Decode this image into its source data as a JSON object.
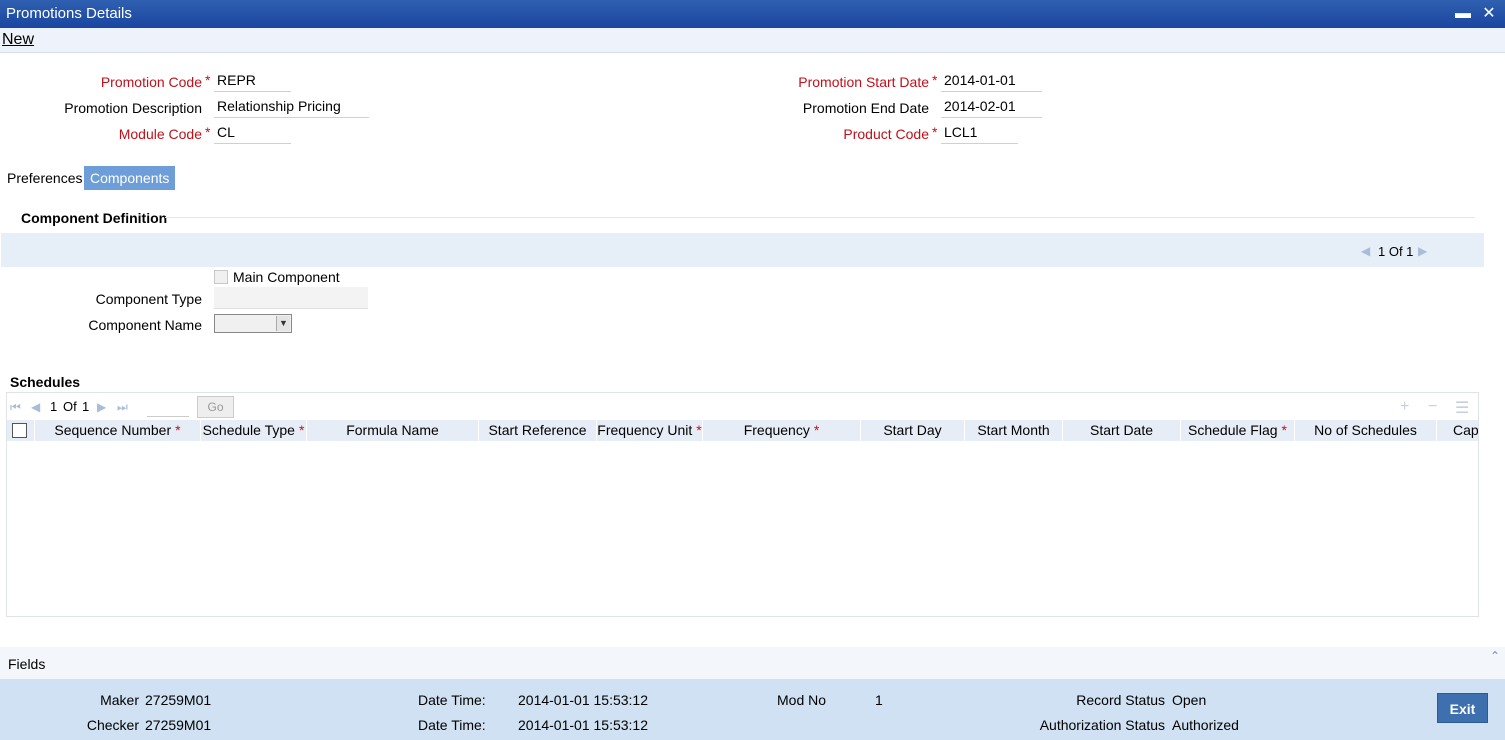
{
  "window": {
    "title": "Promotions Details",
    "minimize_icon": "minimize-icon",
    "close_icon": "close-icon"
  },
  "menu": {
    "new_label": "New"
  },
  "header": {
    "promotion_code_label": "Promotion Code",
    "promotion_code_value": "REPR",
    "promotion_description_label": "Promotion Description",
    "promotion_description_value": "Relationship Pricing",
    "module_code_label": "Module Code",
    "module_code_value": "CL",
    "promotion_start_date_label": "Promotion Start Date",
    "promotion_start_date_value": "2014-01-01",
    "promotion_end_date_label": "Promotion End Date",
    "promotion_end_date_value": "2014-02-01",
    "product_code_label": "Product Code",
    "product_code_value": "LCL1",
    "required_marker": "*"
  },
  "tabs": [
    {
      "label": "Preferences",
      "active": false
    },
    {
      "label": "Components",
      "active": true
    }
  ],
  "component_definition": {
    "title": "Component Definition",
    "pager": "1 Of 1",
    "main_component_label": "Main Component",
    "component_type_label": "Component Type",
    "component_type_value": "",
    "component_name_label": "Component Name",
    "component_name_value": ""
  },
  "schedules": {
    "title": "Schedules",
    "page": "1",
    "of_label": "Of",
    "total_pages": "1",
    "go_label": "Go",
    "columns": [
      {
        "label": "Sequence Number",
        "required": true
      },
      {
        "label": "Schedule Type",
        "required": true
      },
      {
        "label": "Formula Name",
        "required": false
      },
      {
        "label": "Start Reference",
        "required": false
      },
      {
        "label": "Frequency Unit",
        "required": true
      },
      {
        "label": "Frequency",
        "required": true
      },
      {
        "label": "Start Day",
        "required": false
      },
      {
        "label": "Start Month",
        "required": false
      },
      {
        "label": "Start Date",
        "required": false
      },
      {
        "label": "Schedule Flag",
        "required": true
      },
      {
        "label": "No of Schedules",
        "required": false
      },
      {
        "label": "Cap",
        "required": false
      }
    ],
    "rows": []
  },
  "fields_bar": {
    "label": "Fields"
  },
  "footer": {
    "maker_label": "Maker",
    "maker_value": "27259M01",
    "checker_label": "Checker",
    "checker_value": "27259M01",
    "date_time_label": "Date Time:",
    "maker_date_time": "2014-01-01 15:53:12",
    "checker_date_time": "2014-01-01 15:53:12",
    "mod_no_label": "Mod No",
    "mod_no_value": "1",
    "record_status_label": "Record Status",
    "record_status_value": "Open",
    "authorization_status_label": "Authorization Status",
    "authorization_status_value": "Authorized",
    "exit_label": "Exit"
  },
  "colors": {
    "title_bar": "#1a45a0",
    "active_tab": "#6d9ed8",
    "required_label": "#c0101a",
    "footer_bg": "#cfe1f3",
    "exit_button": "#3e6fae"
  }
}
